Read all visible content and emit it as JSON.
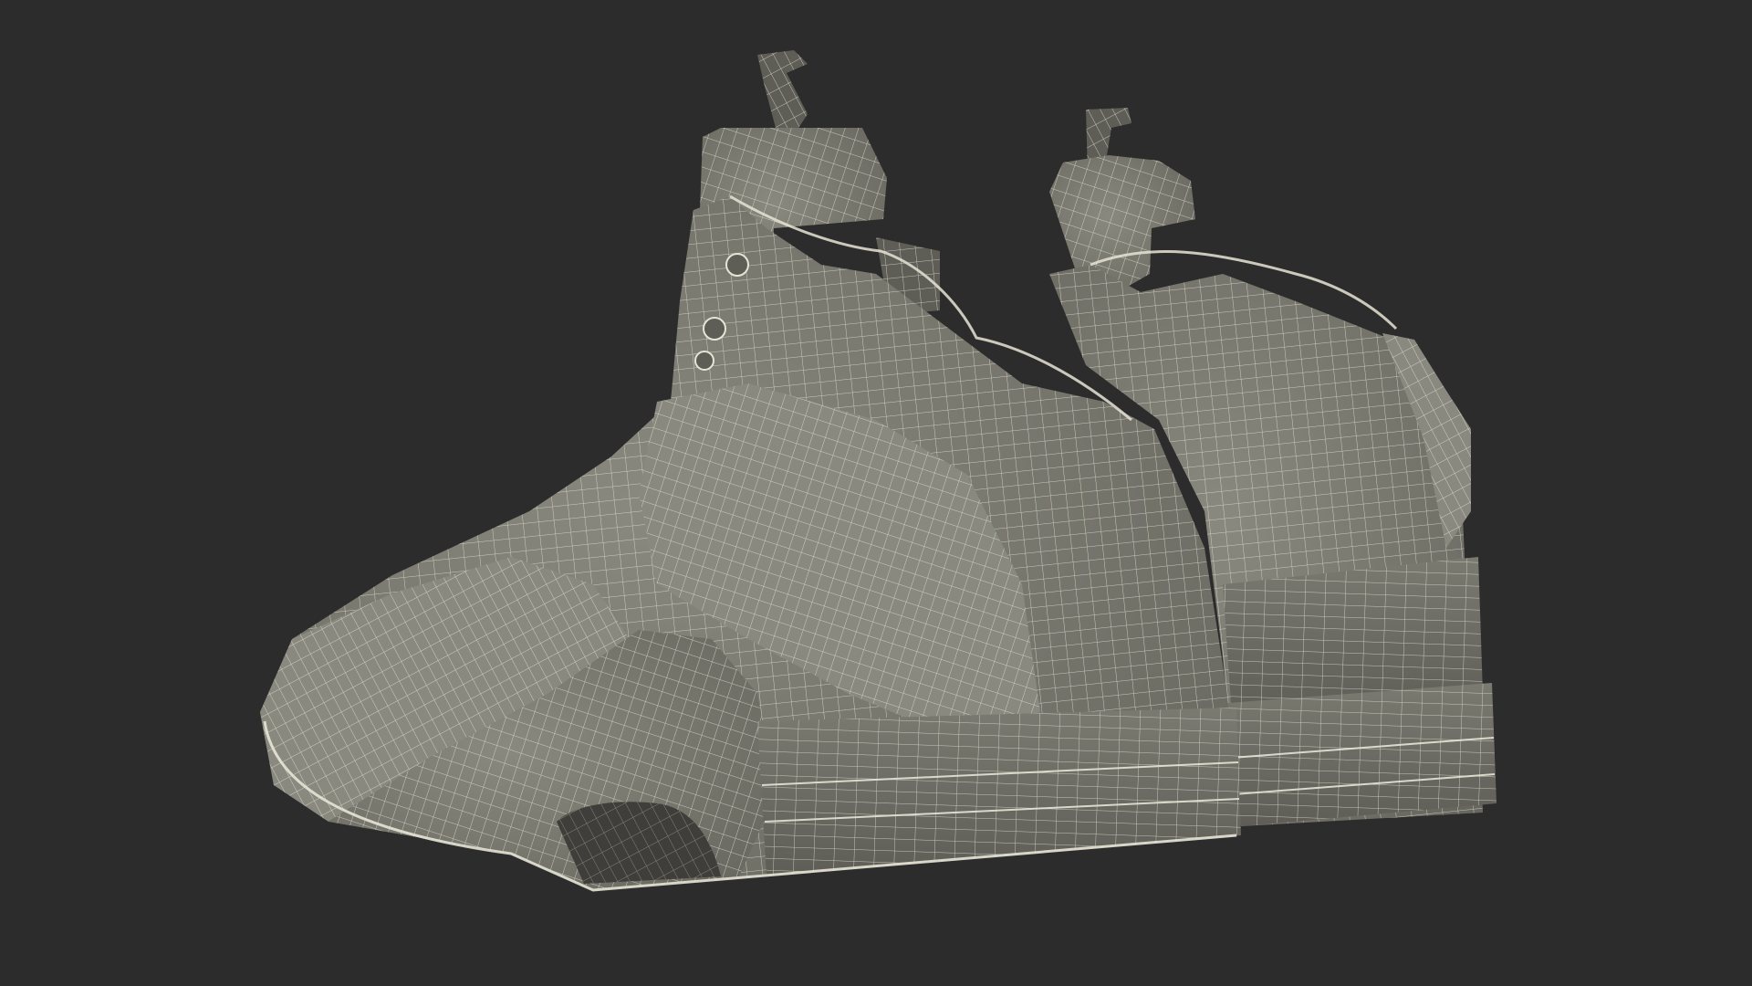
{
  "scene": {
    "subject": "wireframe-sneaker-pair",
    "colors": {
      "background": "#2c2c2c",
      "surface": "#7b7a71",
      "surface_light": "#8a897f",
      "surface_dark": "#5e5d56",
      "shadow": "#3f3e3a",
      "wire": "#e7e4d6"
    }
  }
}
